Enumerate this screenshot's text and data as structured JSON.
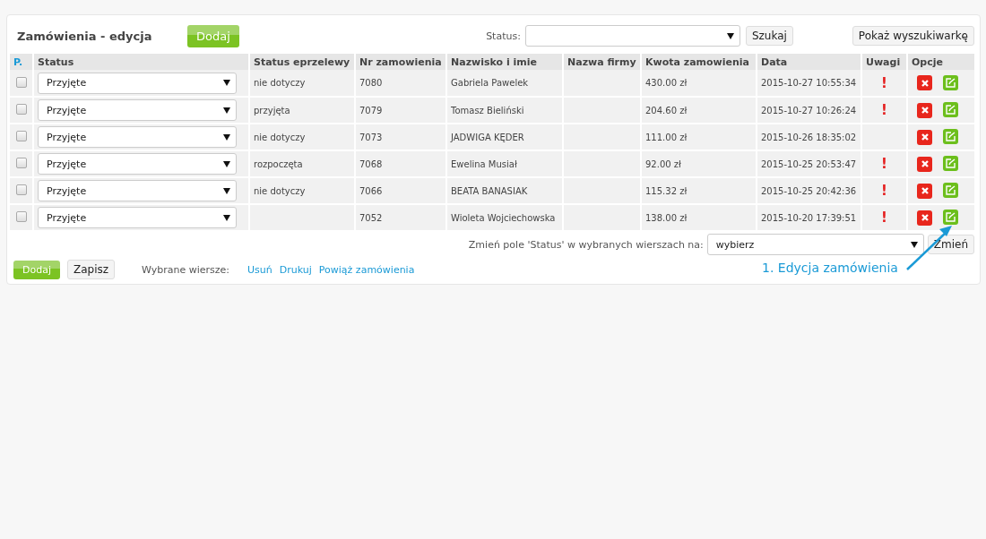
{
  "header": {
    "title": "Zamówienia - edycja",
    "add_button": "Dodaj",
    "status_label": "Status:",
    "search_button": "Szukaj",
    "show_search_button": "Pokaż wyszukiwarkę"
  },
  "table": {
    "columns": [
      "P.",
      "Status",
      "Status eprzelewy",
      "Nr zamowienia",
      "Nazwisko i imie",
      "Nazwa firmy",
      "Kwota zamowienia",
      "Data",
      "Uwagi",
      "Opcje"
    ],
    "rows": [
      {
        "checked": false,
        "status": "Przyjęte",
        "payment": "nie dotyczy",
        "number": "7080",
        "name": "Gabriela Pawelek",
        "amount": "430.00 zł",
        "date": "2015-10-27 10:55:34",
        "warning": true,
        "warning_mark": "!"
      },
      {
        "checked": false,
        "status": "Przyjęte",
        "payment": "przyjęta",
        "number": "7079",
        "name": "Tomasz Bieliński",
        "amount": "204.60 zł",
        "date": "2015-10-27 10:26:24",
        "warning": true,
        "warning_mark": "!"
      },
      {
        "checked": false,
        "status": "Przyjęte",
        "payment": "nie dotyczy",
        "number": "7073",
        "name": "JADWIGA KĘDER",
        "amount": "111.00 zł",
        "date": "2015-10-26 18:35:02",
        "warning": false
      },
      {
        "checked": false,
        "status": "Przyjęte",
        "payment": "rozpoczęta",
        "number": "7068",
        "name": "Ewelina Musiał",
        "amount": "92.00 zł",
        "date": "2015-10-25 20:53:47",
        "warning": true,
        "warning_mark": "!"
      },
      {
        "checked": false,
        "status": "Przyjęte",
        "payment": "nie dotyczy",
        "number": "7066",
        "name": "BEATA BANASIAK",
        "amount": "115.32 zł",
        "date": "2015-10-25 20:42:36",
        "warning": true,
        "warning_mark": "!"
      },
      {
        "checked": false,
        "status": "Przyjęte",
        "number": "7052",
        "name": "Wioleta Wojciechowska",
        "amount": "138.00 zł",
        "date": "2015-10-20 17:39:51",
        "warning": true,
        "warning_mark": "!"
      }
    ]
  },
  "bulk": {
    "label": "Zmień pole 'Status' w wybranych wierszach na:",
    "value": "wybierz",
    "button": "Zmień"
  },
  "footer": {
    "add_button": "Dodaj",
    "save_button": "Zapisz",
    "selected_label": "Wybrane wiersze:",
    "links": [
      "Usuń",
      "Drukuj",
      "Powiąż zamówienia"
    ]
  },
  "annotation": {
    "text": "1. Edycja zamówienia"
  }
}
